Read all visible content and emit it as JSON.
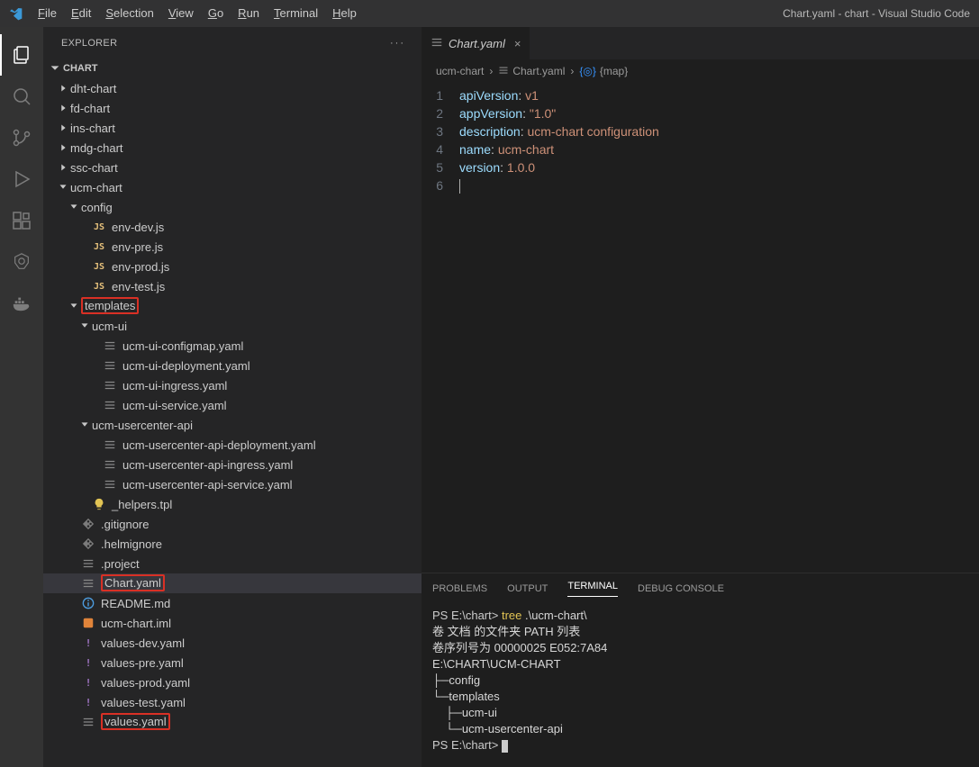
{
  "title": "Chart.yaml - chart - Visual Studio Code",
  "menu": [
    {
      "accel": "F",
      "rest": "ile"
    },
    {
      "accel": "E",
      "rest": "dit"
    },
    {
      "accel": "S",
      "rest": "election"
    },
    {
      "accel": "V",
      "rest": "iew"
    },
    {
      "accel": "G",
      "rest": "o"
    },
    {
      "accel": "R",
      "rest": "un"
    },
    {
      "accel": "T",
      "rest": "erminal"
    },
    {
      "accel": "H",
      "rest": "elp"
    }
  ],
  "explorer": {
    "title": "EXPLORER",
    "section": "CHART",
    "tree": [
      {
        "d": 0,
        "type": "folder",
        "open": false,
        "label": "dht-chart"
      },
      {
        "d": 0,
        "type": "folder",
        "open": false,
        "label": "fd-chart"
      },
      {
        "d": 0,
        "type": "folder",
        "open": false,
        "label": "ins-chart"
      },
      {
        "d": 0,
        "type": "folder",
        "open": false,
        "label": "mdg-chart"
      },
      {
        "d": 0,
        "type": "folder",
        "open": false,
        "label": "ssc-chart"
      },
      {
        "d": 0,
        "type": "folder",
        "open": true,
        "label": "ucm-chart"
      },
      {
        "d": 1,
        "type": "folder",
        "open": true,
        "label": "config"
      },
      {
        "d": 2,
        "type": "file",
        "ic": "js",
        "label": "env-dev.js"
      },
      {
        "d": 2,
        "type": "file",
        "ic": "js",
        "label": "env-pre.js"
      },
      {
        "d": 2,
        "type": "file",
        "ic": "js",
        "label": "env-prod.js"
      },
      {
        "d": 2,
        "type": "file",
        "ic": "js",
        "label": "env-test.js"
      },
      {
        "d": 1,
        "type": "folder",
        "open": true,
        "label": "templates",
        "hl": true
      },
      {
        "d": 2,
        "type": "folder",
        "open": true,
        "label": "ucm-ui"
      },
      {
        "d": 3,
        "type": "file",
        "ic": "yaml",
        "label": "ucm-ui-configmap.yaml"
      },
      {
        "d": 3,
        "type": "file",
        "ic": "yaml",
        "label": "ucm-ui-deployment.yaml"
      },
      {
        "d": 3,
        "type": "file",
        "ic": "yaml",
        "label": "ucm-ui-ingress.yaml"
      },
      {
        "d": 3,
        "type": "file",
        "ic": "yaml",
        "label": "ucm-ui-service.yaml"
      },
      {
        "d": 2,
        "type": "folder",
        "open": true,
        "label": "ucm-usercenter-api"
      },
      {
        "d": 3,
        "type": "file",
        "ic": "yaml",
        "label": "ucm-usercenter-api-deployment.yaml"
      },
      {
        "d": 3,
        "type": "file",
        "ic": "yaml",
        "label": "ucm-usercenter-api-ingress.yaml"
      },
      {
        "d": 3,
        "type": "file",
        "ic": "yaml",
        "label": "ucm-usercenter-api-service.yaml"
      },
      {
        "d": 2,
        "type": "file",
        "ic": "bulb",
        "label": "_helpers.tpl"
      },
      {
        "d": 1,
        "type": "file",
        "ic": "git",
        "label": ".gitignore"
      },
      {
        "d": 1,
        "type": "file",
        "ic": "git",
        "label": ".helmignore"
      },
      {
        "d": 1,
        "type": "file",
        "ic": "yaml",
        "label": ".project"
      },
      {
        "d": 1,
        "type": "file",
        "ic": "yaml",
        "label": "Chart.yaml",
        "hl": true,
        "selected": true
      },
      {
        "d": 1,
        "type": "file",
        "ic": "info",
        "label": "README.md"
      },
      {
        "d": 1,
        "type": "file",
        "ic": "ij",
        "label": "ucm-chart.iml"
      },
      {
        "d": 1,
        "type": "file",
        "ic": "excl",
        "label": "values-dev.yaml"
      },
      {
        "d": 1,
        "type": "file",
        "ic": "excl",
        "label": "values-pre.yaml"
      },
      {
        "d": 1,
        "type": "file",
        "ic": "excl",
        "label": "values-prod.yaml"
      },
      {
        "d": 1,
        "type": "file",
        "ic": "excl",
        "label": "values-test.yaml"
      },
      {
        "d": 1,
        "type": "file",
        "ic": "yaml",
        "label": "values.yaml",
        "hl": true
      }
    ]
  },
  "editor": {
    "tab_label": "Chart.yaml",
    "breadcrumb": [
      "ucm-chart",
      "Chart.yaml",
      "{map}"
    ],
    "code": [
      {
        "n": 1,
        "tokens": [
          [
            "k",
            "apiVersion"
          ],
          [
            "p",
            ": "
          ],
          [
            "v",
            "v1"
          ]
        ]
      },
      {
        "n": 2,
        "tokens": [
          [
            "k",
            "appVersion"
          ],
          [
            "p",
            ": "
          ],
          [
            "s",
            "\"1.0\""
          ]
        ]
      },
      {
        "n": 3,
        "tokens": [
          [
            "k",
            "description"
          ],
          [
            "p",
            ": "
          ],
          [
            "v",
            "ucm-chart configuration"
          ]
        ]
      },
      {
        "n": 4,
        "tokens": [
          [
            "k",
            "name"
          ],
          [
            "p",
            ": "
          ],
          [
            "v",
            "ucm-chart"
          ]
        ]
      },
      {
        "n": 5,
        "tokens": [
          [
            "k",
            "version"
          ],
          [
            "p",
            ": "
          ],
          [
            "v",
            "1.0.0"
          ]
        ]
      },
      {
        "n": 6,
        "tokens": []
      }
    ]
  },
  "panel": {
    "tabs": [
      "PROBLEMS",
      "OUTPUT",
      "TERMINAL",
      "DEBUG CONSOLE"
    ],
    "active": 2,
    "terminal_lines": [
      {
        "segs": [
          [
            "prompt",
            "PS E:\\chart> "
          ],
          [
            "cmd-key",
            "tree"
          ],
          [
            "",
            ".\\ucm-chart\\"
          ]
        ]
      },
      {
        "segs": [
          [
            "",
            "卷 文档 的文件夹 PATH 列表"
          ]
        ]
      },
      {
        "segs": [
          [
            "",
            "卷序列号为 00000025 E052:7A84"
          ]
        ]
      },
      {
        "segs": [
          [
            "",
            "E:\\CHART\\UCM-CHART"
          ]
        ]
      },
      {
        "segs": [
          [
            "",
            "├─config"
          ]
        ]
      },
      {
        "segs": [
          [
            "",
            "└─templates"
          ]
        ]
      },
      {
        "segs": [
          [
            "",
            "    ├─ucm-ui"
          ]
        ]
      },
      {
        "segs": [
          [
            "",
            "    └─ucm-usercenter-api"
          ]
        ]
      },
      {
        "segs": [
          [
            "prompt",
            "PS E:\\chart> "
          ],
          [
            "cursor",
            ""
          ]
        ]
      }
    ]
  }
}
